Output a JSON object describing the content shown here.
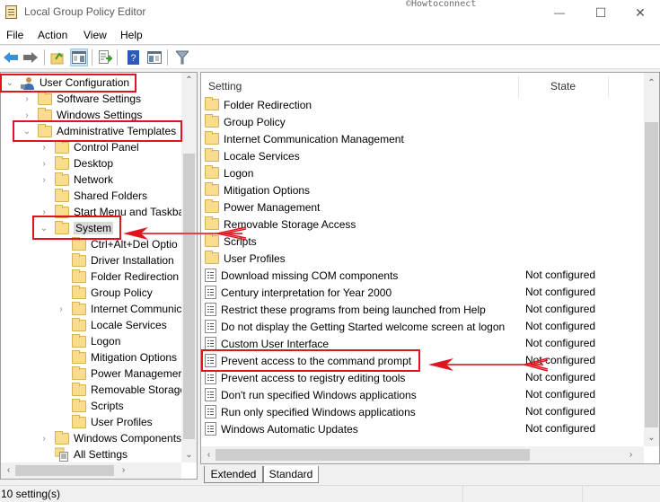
{
  "window": {
    "title": "Local Group Policy Editor",
    "watermark": "©Howtoconnect",
    "minimize_glyph": "—",
    "maximize_glyph": "☐",
    "close_glyph": "✕"
  },
  "menu": [
    "File",
    "Action",
    "View",
    "Help"
  ],
  "toolbar": {
    "buttons": [
      "back-icon",
      "forward-icon",
      "up-folder-icon",
      "show-hide-console-tree-icon",
      "export-list-icon",
      "help-icon",
      "show-hide-action-pane-icon",
      "filter-icon"
    ]
  },
  "tree": {
    "items": [
      {
        "label": "User Configuration",
        "expander": "⌄",
        "icon": "user-icon",
        "highlighted": true
      },
      {
        "label": "Software Settings",
        "expander": "›",
        "icon": "folder-icon"
      },
      {
        "label": "Windows Settings",
        "expander": "›",
        "icon": "folder-icon"
      },
      {
        "label": "Administrative Templates",
        "expander": "⌄",
        "icon": "folder-icon",
        "highlighted": true
      },
      {
        "label": "Control Panel",
        "expander": "›",
        "icon": "folder-icon"
      },
      {
        "label": "Desktop",
        "expander": "›",
        "icon": "folder-icon"
      },
      {
        "label": "Network",
        "expander": "›",
        "icon": "folder-icon"
      },
      {
        "label": "Shared Folders",
        "expander": "",
        "icon": "folder-icon"
      },
      {
        "label": "Start Menu and Taskba",
        "expander": "›",
        "icon": "folder-icon"
      },
      {
        "label": "System",
        "expander": "⌄",
        "icon": "folder-icon",
        "selected": true,
        "highlighted": true
      },
      {
        "label": "Ctrl+Alt+Del Optio",
        "expander": "",
        "icon": "folder-icon"
      },
      {
        "label": "Driver Installation",
        "expander": "",
        "icon": "folder-icon"
      },
      {
        "label": "Folder Redirection",
        "expander": "",
        "icon": "folder-icon"
      },
      {
        "label": "Group Policy",
        "expander": "",
        "icon": "folder-icon"
      },
      {
        "label": "Internet Communic",
        "expander": "›",
        "icon": "folder-icon"
      },
      {
        "label": "Locale Services",
        "expander": "",
        "icon": "folder-icon"
      },
      {
        "label": "Logon",
        "expander": "",
        "icon": "folder-icon"
      },
      {
        "label": "Mitigation Options",
        "expander": "",
        "icon": "folder-icon"
      },
      {
        "label": "Power Managemer",
        "expander": "",
        "icon": "folder-icon"
      },
      {
        "label": "Removable Storage",
        "expander": "",
        "icon": "folder-icon"
      },
      {
        "label": "Scripts",
        "expander": "",
        "icon": "folder-icon"
      },
      {
        "label": "User Profiles",
        "expander": "",
        "icon": "folder-icon"
      },
      {
        "label": "Windows Components",
        "expander": "›",
        "icon": "folder-icon"
      },
      {
        "label": "All Settings",
        "expander": "",
        "icon": "all-settings-icon"
      }
    ]
  },
  "list": {
    "columns": {
      "setting": "Setting",
      "state": "State"
    },
    "rows": [
      {
        "name": "Folder Redirection",
        "type": "folder",
        "state": ""
      },
      {
        "name": "Group Policy",
        "type": "folder",
        "state": ""
      },
      {
        "name": "Internet Communication Management",
        "type": "folder",
        "state": ""
      },
      {
        "name": "Locale Services",
        "type": "folder",
        "state": ""
      },
      {
        "name": "Logon",
        "type": "folder",
        "state": ""
      },
      {
        "name": "Mitigation Options",
        "type": "folder",
        "state": ""
      },
      {
        "name": "Power Management",
        "type": "folder",
        "state": ""
      },
      {
        "name": "Removable Storage Access",
        "type": "folder",
        "state": ""
      },
      {
        "name": "Scripts",
        "type": "folder",
        "state": ""
      },
      {
        "name": "User Profiles",
        "type": "folder",
        "state": ""
      },
      {
        "name": "Download missing COM components",
        "type": "policy",
        "state": "Not configured"
      },
      {
        "name": "Century interpretation for Year 2000",
        "type": "policy",
        "state": "Not configured"
      },
      {
        "name": "Restrict these programs from being launched from Help",
        "type": "policy",
        "state": "Not configured"
      },
      {
        "name": "Do not display the Getting Started welcome screen at logon",
        "type": "policy",
        "state": "Not configured"
      },
      {
        "name": "Custom User Interface",
        "type": "policy",
        "state": "Not configured"
      },
      {
        "name": "Prevent access to the command prompt",
        "type": "policy",
        "state": "Not configured",
        "highlighted": true
      },
      {
        "name": "Prevent access to registry editing tools",
        "type": "policy",
        "state": "Not configured"
      },
      {
        "name": "Don't run specified Windows applications",
        "type": "policy",
        "state": "Not configured"
      },
      {
        "name": "Run only specified Windows applications",
        "type": "policy",
        "state": "Not configured"
      },
      {
        "name": "Windows Automatic Updates",
        "type": "policy",
        "state": "Not configured"
      }
    ]
  },
  "tabs": [
    {
      "label": "Extended",
      "active": false
    },
    {
      "label": "Standard",
      "active": true
    }
  ],
  "status": {
    "text": "10 setting(s)"
  },
  "annotation_color": "#e0141e"
}
